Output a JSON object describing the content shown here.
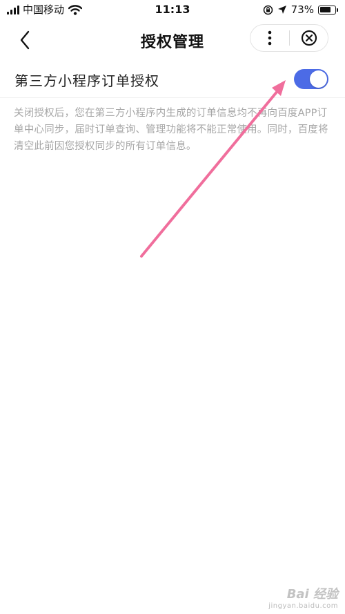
{
  "status_bar": {
    "carrier": "中国移动",
    "time": "11:13",
    "battery_percent": "73%",
    "battery_level": 0.73
  },
  "nav": {
    "title": "授权管理",
    "icons": [
      "chevron-left-icon",
      "more-vertical-icon",
      "close-circle-icon"
    ]
  },
  "setting": {
    "label": "第三方小程序订单授权",
    "enabled": true,
    "toggle_color": "#4c6be6"
  },
  "description": "关闭授权后，您在第三方小程序内生成的订单信息均不再向百度APP订单中心同步，届时订单查询、管理功能将不能正常使用。同时，百度将清空此前因您授权同步的所有订单信息。",
  "annotation": {
    "arrow_color": "#f06e9c"
  },
  "watermark": {
    "brand": "Bai 经验",
    "url": "jingyan.baidu.com"
  }
}
